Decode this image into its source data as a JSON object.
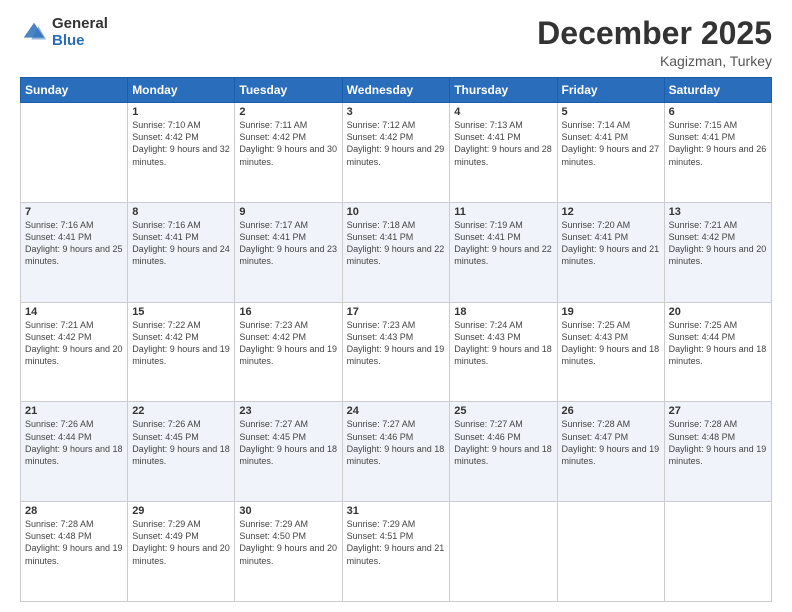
{
  "logo": {
    "general": "General",
    "blue": "Blue"
  },
  "header": {
    "month": "December 2025",
    "location": "Kagizman, Turkey"
  },
  "weekdays": [
    "Sunday",
    "Monday",
    "Tuesday",
    "Wednesday",
    "Thursday",
    "Friday",
    "Saturday"
  ],
  "weeks": [
    [
      {
        "day": "",
        "sunrise": "",
        "sunset": "",
        "daylight": ""
      },
      {
        "day": "1",
        "sunrise": "Sunrise: 7:10 AM",
        "sunset": "Sunset: 4:42 PM",
        "daylight": "Daylight: 9 hours and 32 minutes."
      },
      {
        "day": "2",
        "sunrise": "Sunrise: 7:11 AM",
        "sunset": "Sunset: 4:42 PM",
        "daylight": "Daylight: 9 hours and 30 minutes."
      },
      {
        "day": "3",
        "sunrise": "Sunrise: 7:12 AM",
        "sunset": "Sunset: 4:42 PM",
        "daylight": "Daylight: 9 hours and 29 minutes."
      },
      {
        "day": "4",
        "sunrise": "Sunrise: 7:13 AM",
        "sunset": "Sunset: 4:41 PM",
        "daylight": "Daylight: 9 hours and 28 minutes."
      },
      {
        "day": "5",
        "sunrise": "Sunrise: 7:14 AM",
        "sunset": "Sunset: 4:41 PM",
        "daylight": "Daylight: 9 hours and 27 minutes."
      },
      {
        "day": "6",
        "sunrise": "Sunrise: 7:15 AM",
        "sunset": "Sunset: 4:41 PM",
        "daylight": "Daylight: 9 hours and 26 minutes."
      }
    ],
    [
      {
        "day": "7",
        "sunrise": "Sunrise: 7:16 AM",
        "sunset": "Sunset: 4:41 PM",
        "daylight": "Daylight: 9 hours and 25 minutes."
      },
      {
        "day": "8",
        "sunrise": "Sunrise: 7:16 AM",
        "sunset": "Sunset: 4:41 PM",
        "daylight": "Daylight: 9 hours and 24 minutes."
      },
      {
        "day": "9",
        "sunrise": "Sunrise: 7:17 AM",
        "sunset": "Sunset: 4:41 PM",
        "daylight": "Daylight: 9 hours and 23 minutes."
      },
      {
        "day": "10",
        "sunrise": "Sunrise: 7:18 AM",
        "sunset": "Sunset: 4:41 PM",
        "daylight": "Daylight: 9 hours and 22 minutes."
      },
      {
        "day": "11",
        "sunrise": "Sunrise: 7:19 AM",
        "sunset": "Sunset: 4:41 PM",
        "daylight": "Daylight: 9 hours and 22 minutes."
      },
      {
        "day": "12",
        "sunrise": "Sunrise: 7:20 AM",
        "sunset": "Sunset: 4:41 PM",
        "daylight": "Daylight: 9 hours and 21 minutes."
      },
      {
        "day": "13",
        "sunrise": "Sunrise: 7:21 AM",
        "sunset": "Sunset: 4:42 PM",
        "daylight": "Daylight: 9 hours and 20 minutes."
      }
    ],
    [
      {
        "day": "14",
        "sunrise": "Sunrise: 7:21 AM",
        "sunset": "Sunset: 4:42 PM",
        "daylight": "Daylight: 9 hours and 20 minutes."
      },
      {
        "day": "15",
        "sunrise": "Sunrise: 7:22 AM",
        "sunset": "Sunset: 4:42 PM",
        "daylight": "Daylight: 9 hours and 19 minutes."
      },
      {
        "day": "16",
        "sunrise": "Sunrise: 7:23 AM",
        "sunset": "Sunset: 4:42 PM",
        "daylight": "Daylight: 9 hours and 19 minutes."
      },
      {
        "day": "17",
        "sunrise": "Sunrise: 7:23 AM",
        "sunset": "Sunset: 4:43 PM",
        "daylight": "Daylight: 9 hours and 19 minutes."
      },
      {
        "day": "18",
        "sunrise": "Sunrise: 7:24 AM",
        "sunset": "Sunset: 4:43 PM",
        "daylight": "Daylight: 9 hours and 18 minutes."
      },
      {
        "day": "19",
        "sunrise": "Sunrise: 7:25 AM",
        "sunset": "Sunset: 4:43 PM",
        "daylight": "Daylight: 9 hours and 18 minutes."
      },
      {
        "day": "20",
        "sunrise": "Sunrise: 7:25 AM",
        "sunset": "Sunset: 4:44 PM",
        "daylight": "Daylight: 9 hours and 18 minutes."
      }
    ],
    [
      {
        "day": "21",
        "sunrise": "Sunrise: 7:26 AM",
        "sunset": "Sunset: 4:44 PM",
        "daylight": "Daylight: 9 hours and 18 minutes."
      },
      {
        "day": "22",
        "sunrise": "Sunrise: 7:26 AM",
        "sunset": "Sunset: 4:45 PM",
        "daylight": "Daylight: 9 hours and 18 minutes."
      },
      {
        "day": "23",
        "sunrise": "Sunrise: 7:27 AM",
        "sunset": "Sunset: 4:45 PM",
        "daylight": "Daylight: 9 hours and 18 minutes."
      },
      {
        "day": "24",
        "sunrise": "Sunrise: 7:27 AM",
        "sunset": "Sunset: 4:46 PM",
        "daylight": "Daylight: 9 hours and 18 minutes."
      },
      {
        "day": "25",
        "sunrise": "Sunrise: 7:27 AM",
        "sunset": "Sunset: 4:46 PM",
        "daylight": "Daylight: 9 hours and 18 minutes."
      },
      {
        "day": "26",
        "sunrise": "Sunrise: 7:28 AM",
        "sunset": "Sunset: 4:47 PM",
        "daylight": "Daylight: 9 hours and 19 minutes."
      },
      {
        "day": "27",
        "sunrise": "Sunrise: 7:28 AM",
        "sunset": "Sunset: 4:48 PM",
        "daylight": "Daylight: 9 hours and 19 minutes."
      }
    ],
    [
      {
        "day": "28",
        "sunrise": "Sunrise: 7:28 AM",
        "sunset": "Sunset: 4:48 PM",
        "daylight": "Daylight: 9 hours and 19 minutes."
      },
      {
        "day": "29",
        "sunrise": "Sunrise: 7:29 AM",
        "sunset": "Sunset: 4:49 PM",
        "daylight": "Daylight: 9 hours and 20 minutes."
      },
      {
        "day": "30",
        "sunrise": "Sunrise: 7:29 AM",
        "sunset": "Sunset: 4:50 PM",
        "daylight": "Daylight: 9 hours and 20 minutes."
      },
      {
        "day": "31",
        "sunrise": "Sunrise: 7:29 AM",
        "sunset": "Sunset: 4:51 PM",
        "daylight": "Daylight: 9 hours and 21 minutes."
      },
      {
        "day": "",
        "sunrise": "",
        "sunset": "",
        "daylight": ""
      },
      {
        "day": "",
        "sunrise": "",
        "sunset": "",
        "daylight": ""
      },
      {
        "day": "",
        "sunrise": "",
        "sunset": "",
        "daylight": ""
      }
    ]
  ]
}
